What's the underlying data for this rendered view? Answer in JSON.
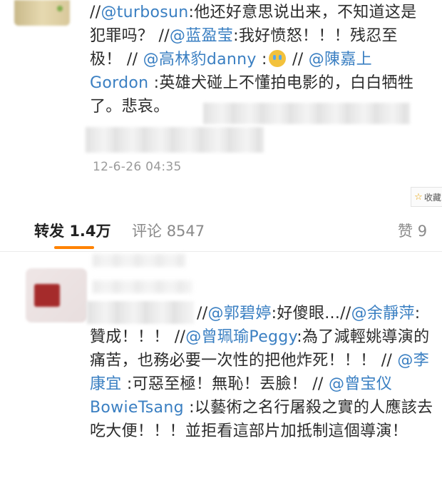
{
  "comment1": {
    "segments": [
      {
        "t": "//",
        "m": false
      },
      {
        "t": "@turbosun",
        "m": true
      },
      {
        "t": ":他还好意思说出来，不知道这是犯罪吗？ //",
        "m": false
      },
      {
        "t": "@蓝盈莹",
        "m": true
      },
      {
        "t": ":我好愤怒！！！残忍至极！ // ",
        "m": false
      },
      {
        "t": "@高林豹danny",
        "m": true
      },
      {
        "t": " :",
        "m": false
      },
      {
        "t": "[emoji]",
        "m": false,
        "emoji": "crying-face"
      },
      {
        "t": " // ",
        "m": false
      },
      {
        "t": "@陳嘉上Gordon",
        "m": true
      },
      {
        "t": " :英雄犬碰上不懂拍电影的，白白牺牲了。悲哀。",
        "m": false
      }
    ],
    "timestamp": "12-6-26 04:35"
  },
  "favorite": {
    "icon": "star-icon",
    "label": "收藏"
  },
  "tabs": {
    "repost_label": "转发",
    "repost_count": "1.4万",
    "comment_label": "评论",
    "comment_count": "8547",
    "like_label": "赞",
    "like_count": "9"
  },
  "comment2": {
    "segments": [
      {
        "t": "//",
        "m": false
      },
      {
        "t": "@郭碧婷",
        "m": true
      },
      {
        "t": ":好傻眼...//",
        "m": false
      },
      {
        "t": "@余靜萍",
        "m": true
      },
      {
        "t": ":贊成！！！ //",
        "m": false
      },
      {
        "t": "@曾珮瑜Peggy",
        "m": true
      },
      {
        "t": ":為了減輕姚導演的痛苦，也務必要一次性的把他炸死！！！ // ",
        "m": false
      },
      {
        "t": "@李康宜",
        "m": true
      },
      {
        "t": " :可惡至極！無恥！丟臉！ // ",
        "m": false
      },
      {
        "t": "@曾宝仪BowieTsang",
        "m": true
      },
      {
        "t": " :以藝術之名行屠殺之實的人應該去吃大便！！！並拒看這部片加抵制這個導演！",
        "m": false
      }
    ]
  },
  "colors": {
    "mention": "#3a7fc2",
    "accent": "#ff8200",
    "text": "#2b2b2b",
    "muted": "#999999"
  }
}
